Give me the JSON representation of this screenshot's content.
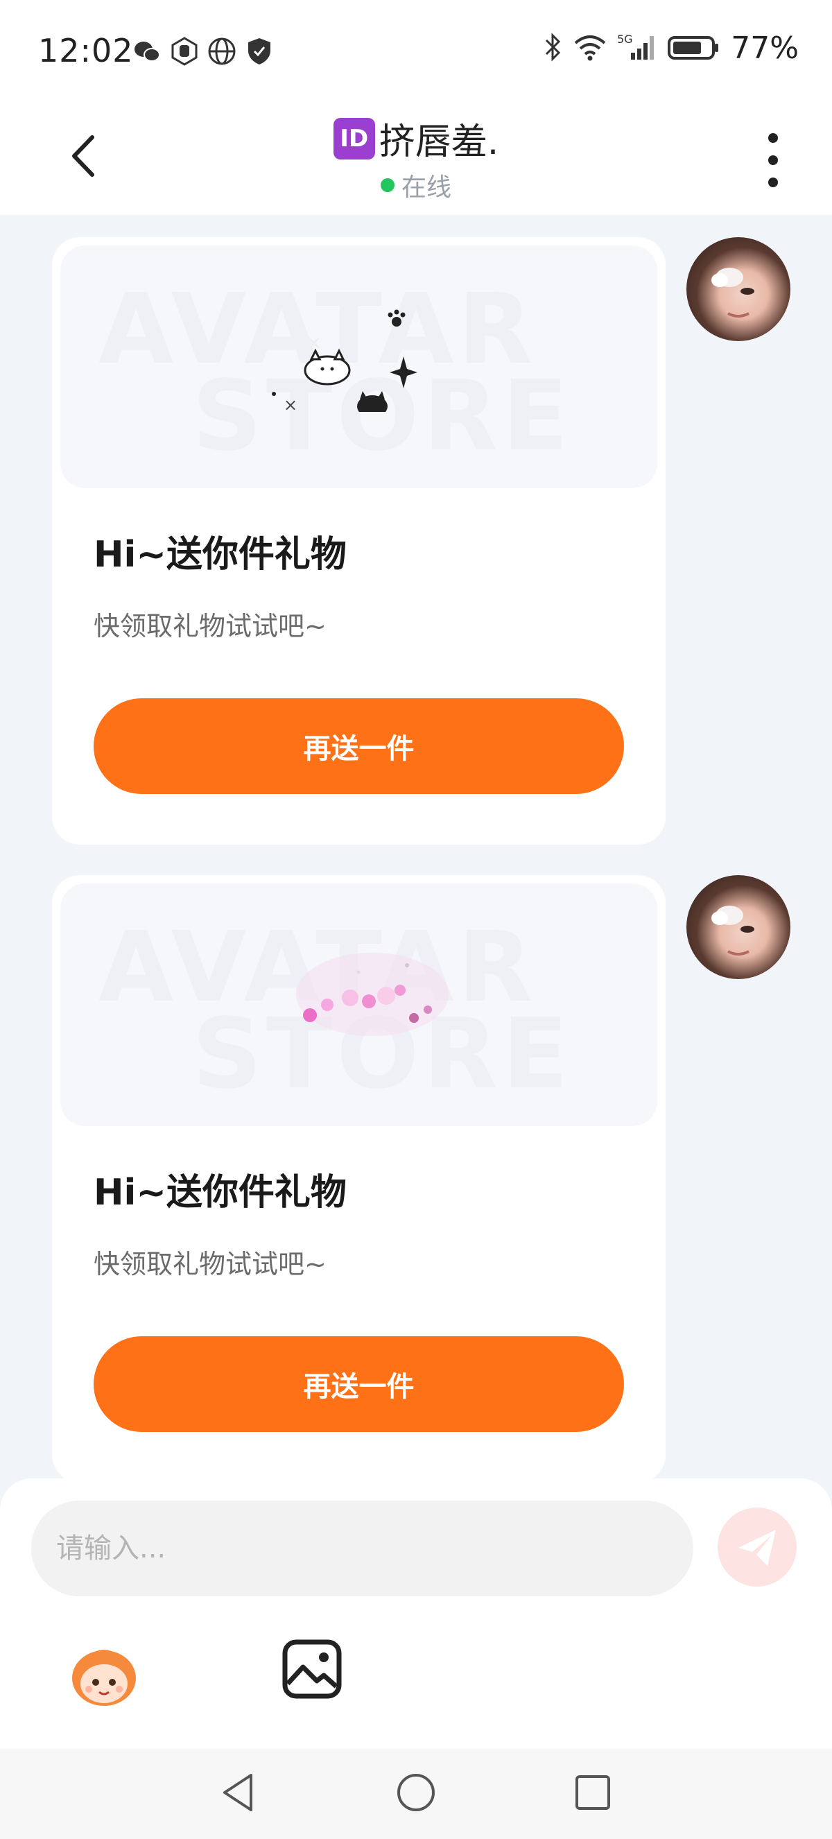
{
  "status_bar": {
    "time": "12:02",
    "battery": "77%",
    "network": "5G"
  },
  "header": {
    "id_badge": "ID",
    "title": "挤唇羞.",
    "online_status": "在线"
  },
  "messages": [
    {
      "type": "gift",
      "title": "Hi~送你件礼物",
      "subtitle": "快领取礼物试试吧~",
      "button_label": "再送一件",
      "preview_watermark_1": "AVATAR",
      "preview_watermark_2": "STORE"
    },
    {
      "type": "gift",
      "title": "Hi~送你件礼物",
      "subtitle": "快领取礼物试试吧~",
      "button_label": "再送一件",
      "preview_watermark_1": "AVATAR",
      "preview_watermark_2": "STORE"
    }
  ],
  "input": {
    "placeholder": "请输入...",
    "value": ""
  },
  "colors": {
    "accent": "#ff7116",
    "online": "#22c55e",
    "send_disabled": "#fde3e1",
    "id_badge": "#9b3fd0"
  },
  "icons": {
    "back": "chevron-left-icon",
    "more": "more-vertical-icon",
    "send": "paper-plane-icon",
    "emoji": "mascot-emoji-icon",
    "image": "image-icon"
  }
}
